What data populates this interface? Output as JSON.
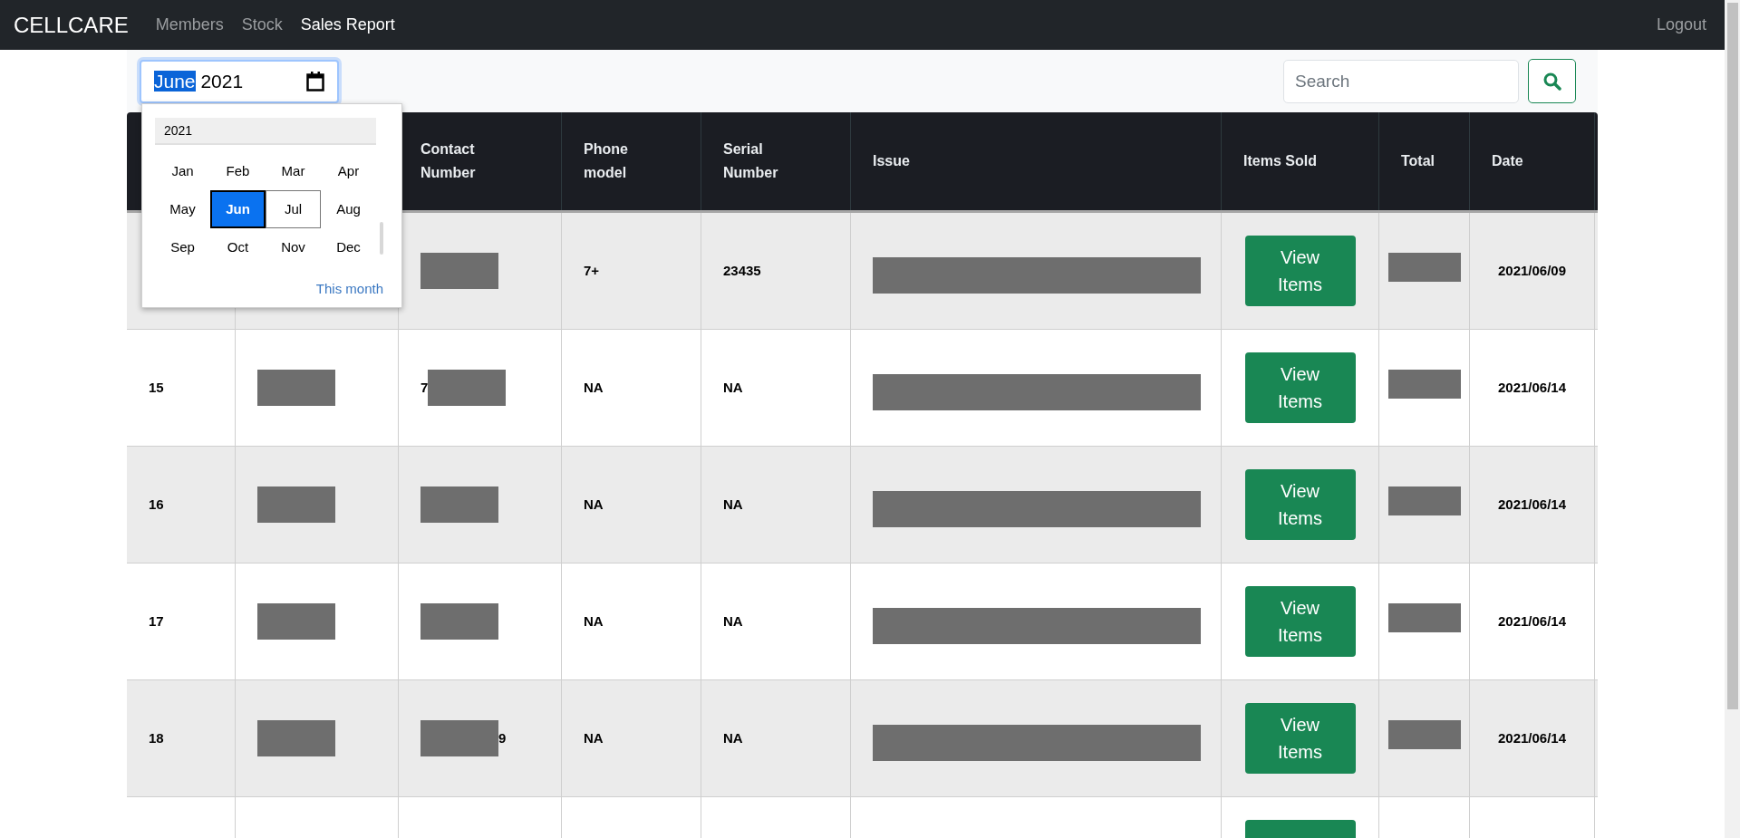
{
  "navbar": {
    "brand": "CELLCARE",
    "links": [
      {
        "label": "Members",
        "selected": false
      },
      {
        "label": "Stock",
        "selected": false
      },
      {
        "label": "Sales Report",
        "selected": true
      }
    ],
    "logout": "Logout"
  },
  "month_field": {
    "month": "June",
    "year": "2021"
  },
  "month_picker": {
    "year": "2021",
    "months": [
      {
        "label": "Jan",
        "selected": false,
        "hovered": false
      },
      {
        "label": "Feb",
        "selected": false,
        "hovered": false
      },
      {
        "label": "Mar",
        "selected": false,
        "hovered": false
      },
      {
        "label": "Apr",
        "selected": false,
        "hovered": false
      },
      {
        "label": "May",
        "selected": false,
        "hovered": false
      },
      {
        "label": "Jun",
        "selected": true,
        "hovered": false
      },
      {
        "label": "Jul",
        "selected": false,
        "hovered": true
      },
      {
        "label": "Aug",
        "selected": false,
        "hovered": false
      },
      {
        "label": "Sep",
        "selected": false,
        "hovered": false
      },
      {
        "label": "Oct",
        "selected": false,
        "hovered": false
      },
      {
        "label": "Nov",
        "selected": false,
        "hovered": false
      },
      {
        "label": "Dec",
        "selected": false,
        "hovered": false
      }
    ],
    "this_month": "This month"
  },
  "search": {
    "placeholder": "Search"
  },
  "table": {
    "columns": [
      "",
      "",
      "Contact Number",
      "Phone model",
      "Serial Number",
      "Issue",
      "Items Sold",
      "Total",
      "Date"
    ],
    "rows": [
      {
        "kind": "full",
        "contact": {
          "redacted": true
        },
        "model": "7+",
        "serial": "23435",
        "issue": {
          "redacted": true
        },
        "button": "View Items",
        "total": {
          "redacted": true
        },
        "date": "2021/06/09"
      },
      {
        "kind": "full",
        "no": "15",
        "customer": {
          "redacted": true
        },
        "contact": {
          "redacted": true,
          "before": "7"
        },
        "model": "NA",
        "serial": "NA",
        "issue": {
          "redacted": true
        },
        "button": "View Items",
        "total": {
          "redacted": true
        },
        "date": "2021/06/14"
      },
      {
        "kind": "full",
        "no": "16",
        "customer": {
          "redacted": true
        },
        "contact": {
          "redacted": true
        },
        "model": "NA",
        "serial": "NA",
        "issue": {
          "redacted": true
        },
        "button": "View Items",
        "total": {
          "redacted": true
        },
        "date": "2021/06/14"
      },
      {
        "kind": "full",
        "no": "17",
        "customer": {
          "redacted": true
        },
        "contact": {
          "redacted": true
        },
        "model": "NA",
        "serial": "NA",
        "issue": {
          "redacted": true
        },
        "button": "View Items",
        "total": {
          "redacted": true
        },
        "date": "2021/06/14"
      },
      {
        "kind": "full",
        "no": "18",
        "customer": {
          "redacted": true
        },
        "contact": {
          "redacted": true,
          "after": "9"
        },
        "model": "NA",
        "serial": "NA",
        "issue": {
          "redacted": true
        },
        "button": "View Items",
        "total": {
          "redacted": true
        },
        "date": "2021/06/14"
      },
      {
        "kind": "partial"
      }
    ]
  }
}
